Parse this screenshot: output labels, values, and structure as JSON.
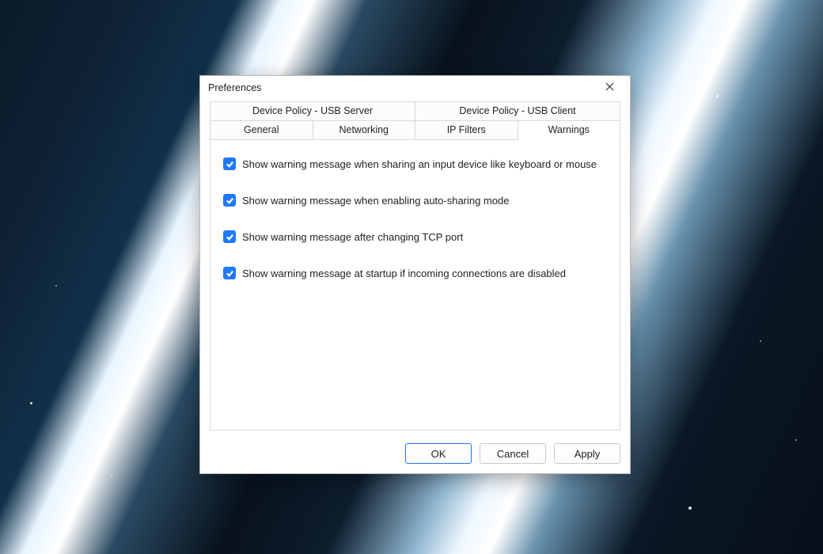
{
  "dialog": {
    "title": "Preferences"
  },
  "tabs_row1": [
    {
      "label": "Device Policy - USB Server"
    },
    {
      "label": "Device Policy - USB Client"
    }
  ],
  "tabs_row2": [
    {
      "label": "General"
    },
    {
      "label": "Networking"
    },
    {
      "label": "IP Filters"
    },
    {
      "label": "Warnings"
    }
  ],
  "active_tab": "Warnings",
  "options": [
    {
      "checked": true,
      "label": "Show warning message when sharing an input device like keyboard or mouse"
    },
    {
      "checked": true,
      "label": "Show warning message when enabling auto-sharing mode"
    },
    {
      "checked": true,
      "label": "Show warning message after changing TCP port"
    },
    {
      "checked": true,
      "label": "Show warning message at startup if incoming connections are disabled"
    }
  ],
  "buttons": {
    "ok": "OK",
    "cancel": "Cancel",
    "apply": "Apply"
  }
}
